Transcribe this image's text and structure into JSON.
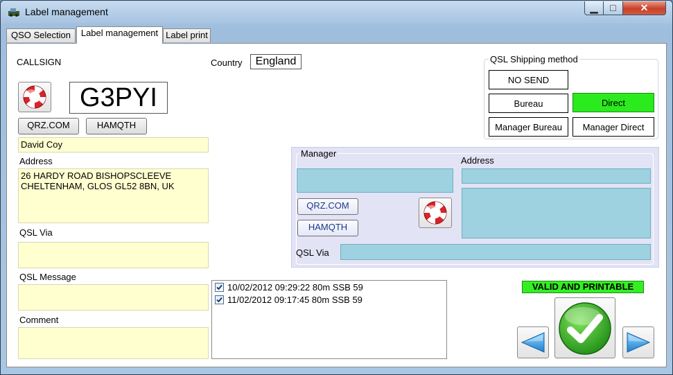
{
  "window": {
    "title": "Label management"
  },
  "tabs": [
    {
      "label": "QSO Selection"
    },
    {
      "label": "Label management"
    },
    {
      "label": "Label print"
    }
  ],
  "callsign": {
    "label": "CALLSIGN",
    "value": "G3PYI"
  },
  "country": {
    "label": "Country",
    "value": "England"
  },
  "lookup": {
    "qrz_label": "QRZ.COM",
    "hamqth_label": "HAMQTH"
  },
  "contact": {
    "name": "David Coy",
    "address_label": "Address",
    "address": "26 HARDY ROAD BISHOPSCLEEVE\nCHELTENHAM, GLOS GL52 8BN, UK",
    "qsl_via_label": "QSL Via",
    "qsl_via": "",
    "qsl_message_label": "QSL Message",
    "qsl_message": "",
    "comment_label": "Comment",
    "comment": ""
  },
  "shipping": {
    "title": "QSL Shipping method",
    "no_send": "NO SEND",
    "bureau": "Bureau",
    "direct": "Direct",
    "manager_bureau": "Manager Bureau",
    "manager_direct": "Manager Direct",
    "selected": "Direct",
    "selected_color": "#2bea1e"
  },
  "manager": {
    "title": "Manager",
    "address_label": "Address",
    "qrz_label": "QRZ.COM",
    "hamqth_label": "HAMQTH",
    "qsl_via_label": "QSL Via"
  },
  "qsos": [
    {
      "checked": true,
      "text": "10/02/2012 09:29:22 80m SSB 59"
    },
    {
      "checked": true,
      "text": "11/02/2012 09:17:45 80m SSB 59"
    }
  ],
  "status": {
    "text": "VALID AND PRINTABLE",
    "color": "#33ef22"
  },
  "icons": {
    "app": "app-icon",
    "lookup": "lifebuoy-icon",
    "confirm": "checkmark-icon",
    "prev": "arrow-left-icon",
    "next": "arrow-right-icon"
  }
}
